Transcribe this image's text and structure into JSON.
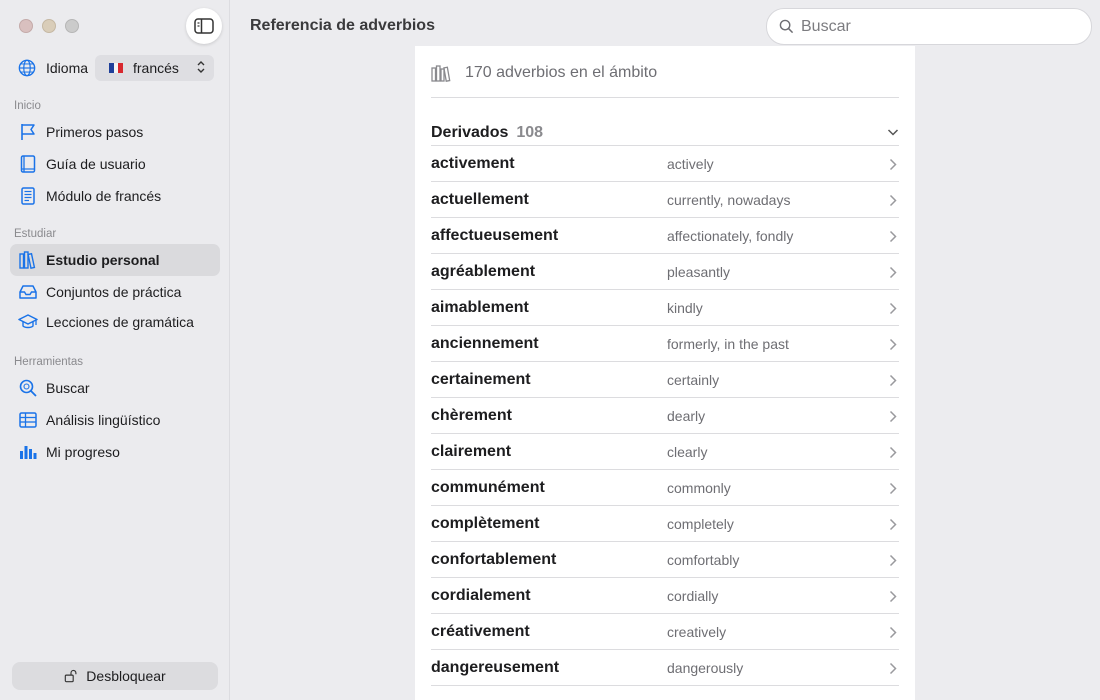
{
  "sidebar": {
    "language_label": "Idioma",
    "language_value": "francés",
    "sections": {
      "inicio": "Inicio",
      "estudiar": "Estudiar",
      "herramientas": "Herramientas"
    },
    "items": [
      {
        "label": "Primeros pasos",
        "icon": "flag-icon"
      },
      {
        "label": "Guía de usuario",
        "icon": "book-icon"
      },
      {
        "label": "Módulo de francés",
        "icon": "document-icon"
      },
      {
        "label": "Estudio personal",
        "icon": "books-icon"
      },
      {
        "label": "Conjuntos de práctica",
        "icon": "tray-icon"
      },
      {
        "label": "Lecciones de gramática",
        "icon": "graduation-cap-icon"
      },
      {
        "label": "Buscar",
        "icon": "search-icon"
      },
      {
        "label": "Análisis lingüístico",
        "icon": "table-icon"
      },
      {
        "label": "Mi progreso",
        "icon": "bar-chart-icon"
      }
    ],
    "unlock_label": "Desbloquear"
  },
  "header": {
    "title": "Referencia de adverbios",
    "search_placeholder": "Buscar"
  },
  "content": {
    "scope_text": "170 adverbios en el ámbito",
    "group": {
      "name": "Derivados",
      "count": "108"
    },
    "rows": [
      {
        "word": "activement",
        "translation": "actively"
      },
      {
        "word": "actuellement",
        "translation": "currently, nowadays"
      },
      {
        "word": "affectueusement",
        "translation": "affectionately, fondly"
      },
      {
        "word": "agréablement",
        "translation": "pleasantly"
      },
      {
        "word": "aimablement",
        "translation": "kindly"
      },
      {
        "word": "anciennement",
        "translation": "formerly, in the past"
      },
      {
        "word": "certainement",
        "translation": "certainly"
      },
      {
        "word": "chèrement",
        "translation": "dearly"
      },
      {
        "word": "clairement",
        "translation": "clearly"
      },
      {
        "word": "communément",
        "translation": "commonly"
      },
      {
        "word": "complètement",
        "translation": "completely"
      },
      {
        "word": "confortablement",
        "translation": "comfortably"
      },
      {
        "word": "cordialement",
        "translation": "cordially"
      },
      {
        "word": "créativement",
        "translation": "creatively"
      },
      {
        "word": "dangereusement",
        "translation": "dangerously"
      }
    ]
  },
  "colors": {
    "accent": "#1a73e8",
    "sidebar_bg": "#ebebee",
    "panel_bg": "#ffffff"
  }
}
